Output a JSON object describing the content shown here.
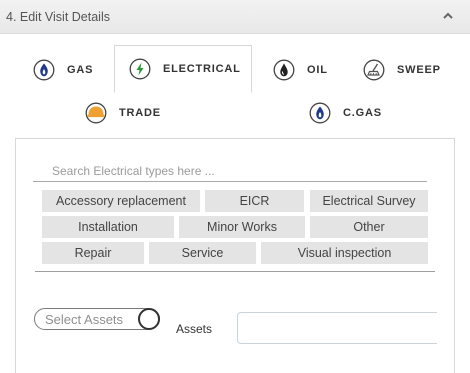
{
  "panel": {
    "title": "4. Edit Visit Details",
    "collapse_icon": "chevron-up-icon"
  },
  "tabs": [
    {
      "label": "GAS",
      "icon": "gas-flame-icon",
      "active": false
    },
    {
      "label": "ELECTRICAL",
      "icon": "lightning-bolt-icon",
      "active": true
    },
    {
      "label": "OIL",
      "icon": "oil-drop-icon",
      "active": false
    },
    {
      "label": "SWEEP",
      "icon": "sweep-icon",
      "active": false
    },
    {
      "label": "TRADE",
      "icon": "trade-helmet-icon",
      "active": false
    },
    {
      "label": "C.GAS",
      "icon": "commercial-gas-flame-icon",
      "active": false
    }
  ],
  "search": {
    "placeholder": "Search Electrical types here ...",
    "value": ""
  },
  "electrical_types": [
    "Accessory replacement",
    "EICR",
    "Electrical Survey",
    "Installation",
    "Minor Works",
    "Other",
    "Repair",
    "Service",
    "Visual inspection"
  ],
  "assets": {
    "toggle_label": "Select Assets",
    "label": "Assets",
    "value": ""
  },
  "colors": {
    "gas_blue": "#1f3a8a",
    "electrical_green": "#2a9a3a",
    "trade_orange": "#f0a030",
    "chip_bg": "#e4e4e4"
  }
}
